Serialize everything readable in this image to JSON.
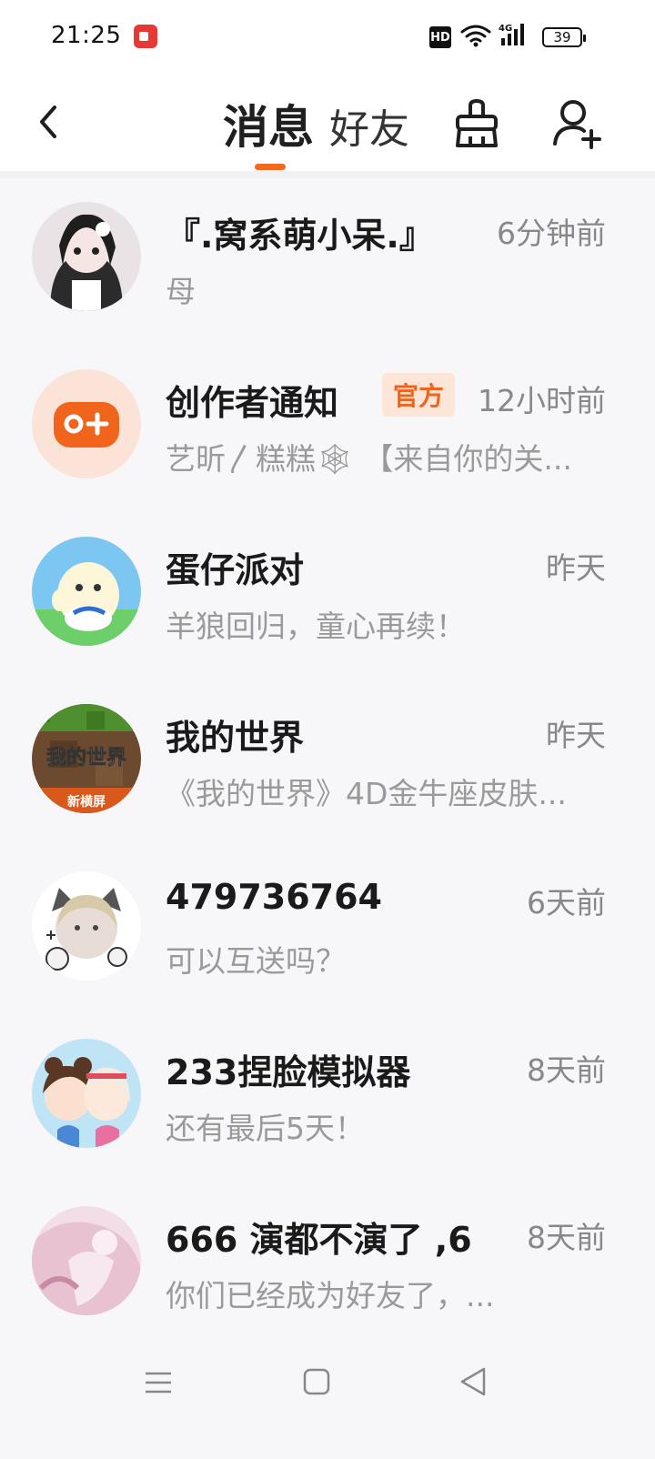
{
  "status_bar": {
    "time": "21:25",
    "hd_label": "HD",
    "network_label": "4G",
    "battery_level": "39"
  },
  "header": {
    "tabs": [
      {
        "label": "消息",
        "active": true
      },
      {
        "label": "好友",
        "active": false
      }
    ],
    "accent_color": "#f26b1d"
  },
  "conversations": [
    {
      "name": "『.窝系萌小呆.』",
      "time": "6分钟前",
      "preview": "母"
    },
    {
      "name": "创作者通知",
      "badge": "官方",
      "time": "12小时前",
      "preview": "艺昕〳糕糕🕸 【来自你的关..."
    },
    {
      "name": "蛋仔派对",
      "time": "昨天",
      "preview": "羊狼回归，童心再续！"
    },
    {
      "name": "我的世界",
      "time": "昨天",
      "preview": "《我的世界》4D金牛座皮肤...",
      "avatar_text": "我的世界",
      "avatar_sub": "新横屏"
    },
    {
      "name": "479736764",
      "time": "6天前",
      "preview": "可以互送吗？"
    },
    {
      "name": "233捏脸模拟器",
      "time": "8天前",
      "preview": "还有最后5天！"
    },
    {
      "name": "666 演都不演了 ,6",
      "time": "8天前",
      "preview": "你们已经成为好友了，..."
    }
  ]
}
